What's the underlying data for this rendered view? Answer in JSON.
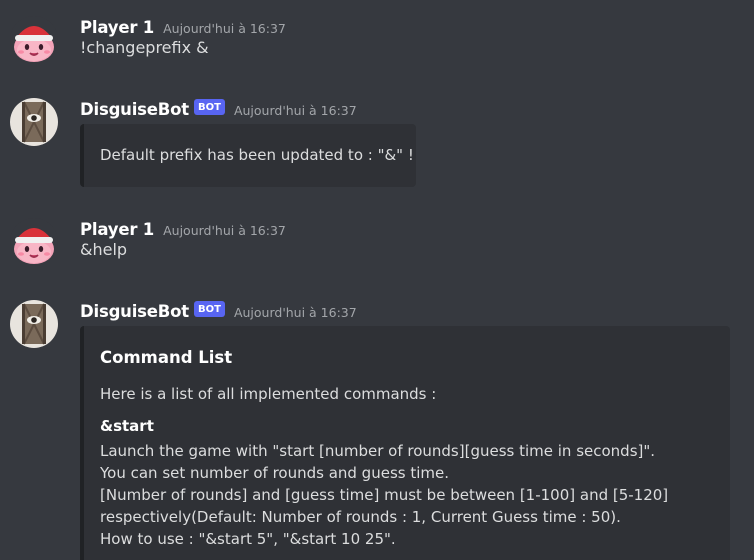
{
  "messages": [
    {
      "author": "Player 1",
      "timestamp": "Aujourd'hui à 16:37",
      "text": "!changeprefix &"
    },
    {
      "author": "DisguiseBot",
      "bot_tag": "BOT",
      "timestamp": "Aujourd'hui à 16:37",
      "embed_text": "Default prefix has been updated to : \"&\" !"
    },
    {
      "author": "Player 1",
      "timestamp": "Aujourd'hui à 16:37",
      "text": "&help"
    },
    {
      "author": "DisguiseBot",
      "bot_tag": "BOT",
      "timestamp": "Aujourd'hui à 16:37",
      "embed": {
        "title": "Command List",
        "description": "Here is a list of all implemented commands :",
        "field_name": "&start",
        "field_lines": [
          "Launch the game with \"start [number of rounds][guess time in seconds]\".",
          "You can set number of rounds and guess time.",
          "[Number of rounds] and [guess time] must be between [1-100] and [5-120]",
          "respectively(Default: Number of rounds : 1, Current Guess time : 50).",
          "How to use : \"&start 5\", \"&start 10 25\"."
        ]
      }
    }
  ],
  "colors": {
    "background": "#36393f",
    "embed_background": "#2f3136",
    "bot_tag": "#5865f2",
    "username": "#ffffff",
    "timestamp": "#a3a6aa",
    "text": "#dcddde"
  },
  "icons": {
    "player_avatar": "pink-blob-santa-hat-avatar",
    "bot_avatar": "eye-door-avatar"
  }
}
